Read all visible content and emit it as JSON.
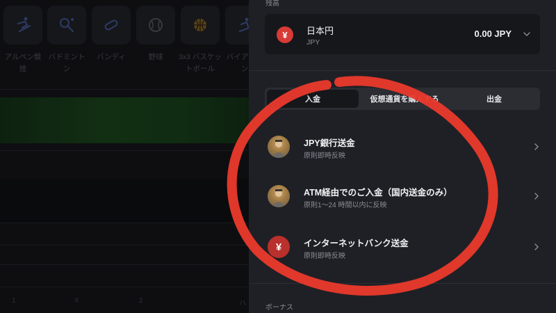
{
  "background_app": {
    "sports": [
      {
        "label": "アルペン競技",
        "icon": "skiing-icon"
      },
      {
        "label": "バドミントン",
        "icon": "badminton-icon"
      },
      {
        "label": "バンディ",
        "icon": "bandy-icon"
      },
      {
        "label": "野球",
        "icon": "baseball-icon"
      },
      {
        "label": "3x3 バスケットボール",
        "icon": "basketball-icon"
      },
      {
        "label": "バイアスロン",
        "icon": "biathlon-icon"
      }
    ],
    "bottom_labels": [
      "1",
      "X",
      "2",
      "ハ"
    ]
  },
  "wallet": {
    "balance_title": "残高",
    "currency": {
      "symbol": "¥",
      "name": "日本円",
      "code": "JPY",
      "amount": "0.00 JPY"
    },
    "tabs": [
      {
        "label": "入金",
        "active": true
      },
      {
        "label": "仮想通貨を購入する",
        "active": false
      },
      {
        "label": "出金",
        "active": false
      }
    ],
    "methods": [
      {
        "title": "JPY銀行送金",
        "subtitle": "原則即時反映",
        "icon": "bank-avatar-icon"
      },
      {
        "title": "ATM経由でのご入金（国内送金のみ）",
        "subtitle": "原則1〜24 時間以内に反映",
        "icon": "atm-avatar-icon"
      },
      {
        "title": "インターネットバンク送金",
        "subtitle": "原則即時反映",
        "icon": "yen-icon",
        "symbol": "¥"
      }
    ],
    "bonus_title": "ボーナス"
  },
  "colors": {
    "panel_bg": "#1f2025",
    "card_bg": "#16171b",
    "yen_red": "#d73b36",
    "annotation_red": "#e8392c",
    "green_band": "#1d4b20"
  }
}
